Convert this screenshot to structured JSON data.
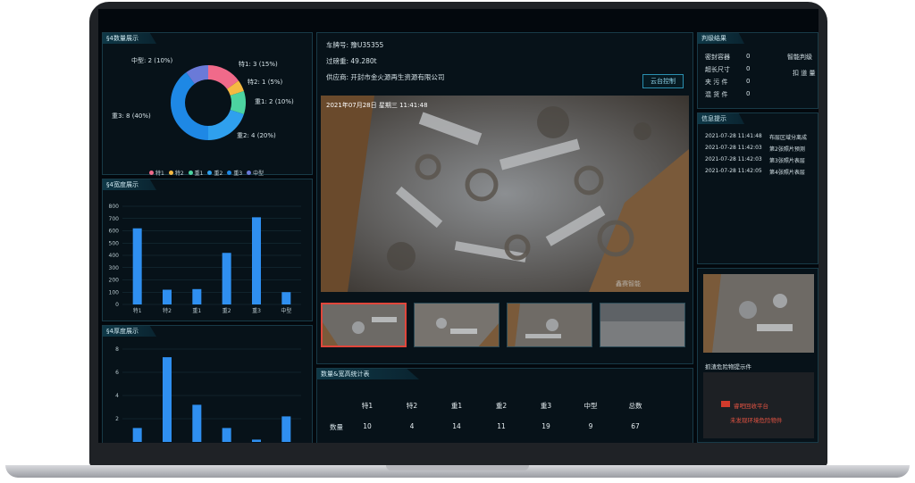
{
  "weight_panel": {
    "title": "§4数量展示",
    "labels": {
      "zhongxing": "中型: 2 (10%)",
      "te1": "特1: 3 (15%)",
      "te2": "特2: 1 (5%)",
      "zhong1": "重1: 2 (10%)",
      "zhong3": "重3: 8 (40%)",
      "zhong2": "重2: 4 (20%)"
    },
    "legend": [
      "特1",
      "特2",
      "重1",
      "重2",
      "重3",
      "中型"
    ],
    "colors": [
      "#f06a8a",
      "#f5b942",
      "#4cd3a0",
      "#2fa0ee",
      "#1e88e5",
      "#6a7ad8"
    ]
  },
  "chart_data": [
    {
      "type": "pie",
      "title": "",
      "categories": [
        "特1",
        "特2",
        "重1",
        "重2",
        "重3",
        "中型"
      ],
      "values": [
        3,
        1,
        2,
        4,
        8,
        2
      ]
    },
    {
      "type": "bar",
      "title": "§4宽度展示",
      "categories": [
        "特1",
        "特2",
        "重1",
        "重2",
        "重3",
        "中型"
      ],
      "values": [
        620,
        120,
        125,
        420,
        710,
        100
      ],
      "ylim": [
        0,
        800
      ],
      "yticks": [
        "0",
        "100",
        "200",
        "300",
        "400",
        "500",
        "600",
        "700",
        "800"
      ]
    },
    {
      "type": "bar",
      "title": "§4厚度展示",
      "categories": [
        "",
        "",
        "",
        "",
        "",
        ""
      ],
      "values": [
        1.2,
        7.3,
        3.2,
        1.2,
        0.2,
        2.2
      ],
      "ylim": [
        0,
        8
      ],
      "yticks": [
        "2",
        "4",
        "6",
        "8"
      ]
    }
  ],
  "vehicle": {
    "plate_label": "车牌号: 豫U35355",
    "weight_label": "过磅重: 49.280t",
    "supplier_label": "供应商: 开封市金火源再生资源有限公司",
    "ptz_button": "云台控制",
    "overlay_text": "2021年07月28日 星期三 11:41:48",
    "watermark": "鑫赛智能"
  },
  "stats_table": {
    "title": "数量&宽高统计表",
    "headers": [
      "特1",
      "特2",
      "重1",
      "重2",
      "重3",
      "中型",
      "总数"
    ],
    "row_label": "数量",
    "values": [
      "10",
      "4",
      "14",
      "11",
      "19",
      "9",
      "67"
    ]
  },
  "grading": {
    "title": "判级结果",
    "items": [
      {
        "label": "密封容器",
        "value": "0"
      },
      {
        "label": "超长尺寸",
        "value": "0"
      },
      {
        "label": "夹 污 件",
        "value": "0"
      },
      {
        "label": "混 货 件",
        "value": "0"
      }
    ],
    "side1": "智能判级",
    "side2": "扣 道 量"
  },
  "info": {
    "title": "信息提示",
    "rows": [
      {
        "time": "2021-07-28 11:41:48",
        "msg": "布层区域分离成"
      },
      {
        "time": "2021-07-28 11:42:03",
        "msg": "第2张照片预测"
      },
      {
        "time": "2021-07-28 11:42:03",
        "msg": "第3张照片表层"
      },
      {
        "time": "2021-07-28 11:42:05",
        "msg": "第4张照片表层"
      }
    ]
  },
  "alert_panel": {
    "label": "抓渣危险物提示件",
    "brand": "睿吧回收平台",
    "sub": "未发现环境危险物件"
  }
}
